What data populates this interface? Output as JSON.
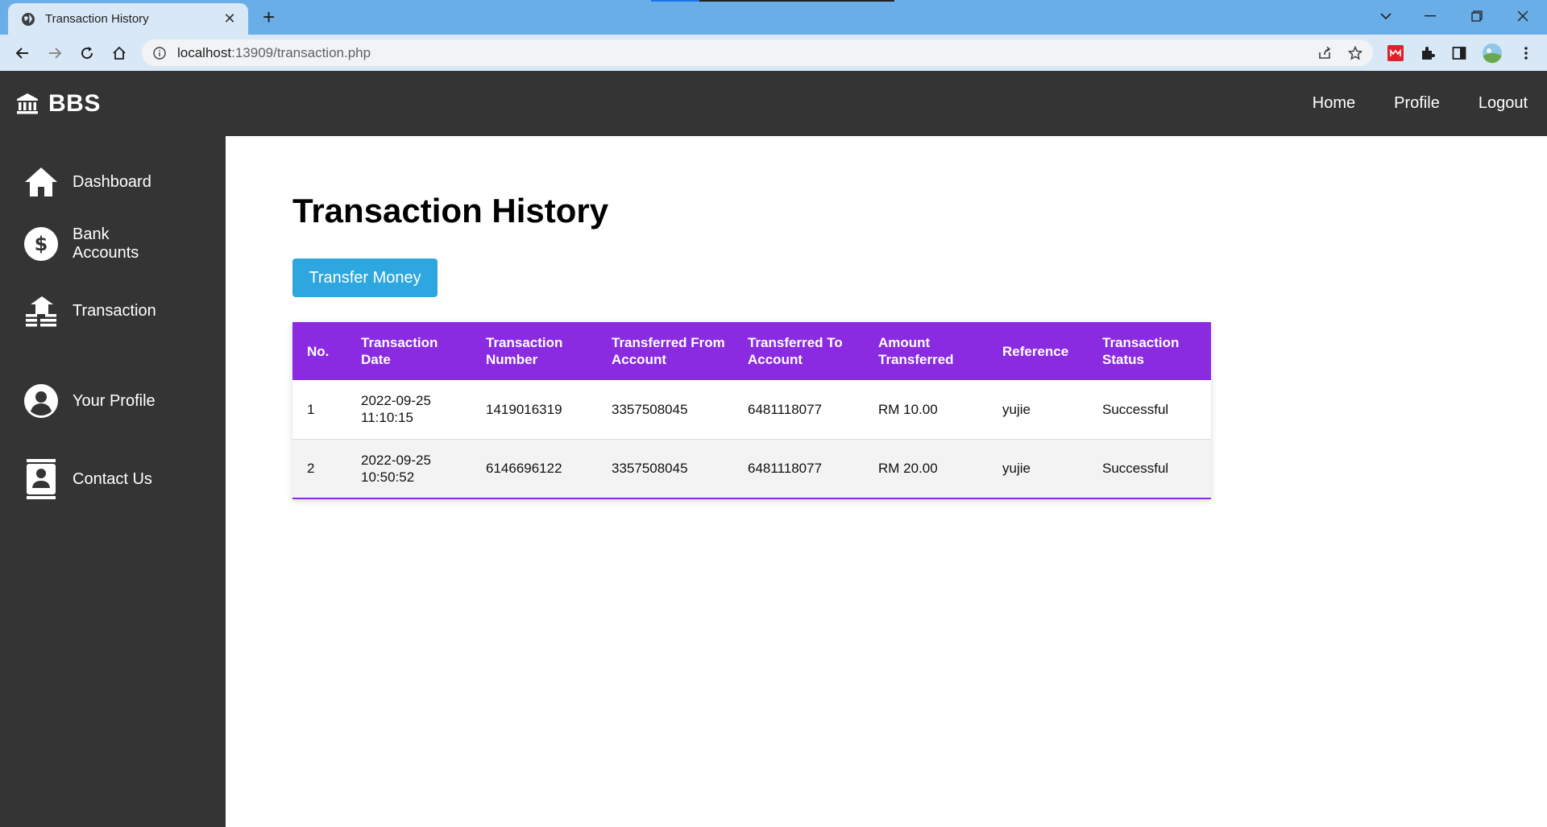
{
  "browser": {
    "tab_title": "Transaction History",
    "tab_close": "✕",
    "new_tab": "+",
    "url_host": "localhost",
    "url_rest": ":13909/transaction.php"
  },
  "header": {
    "brand": "BBS",
    "nav": [
      "Home",
      "Profile",
      "Logout"
    ]
  },
  "sidebar": {
    "items": [
      {
        "label": "Dashboard",
        "icon": "home-icon"
      },
      {
        "label": "Bank Accounts",
        "icon": "dollar-circle-icon"
      },
      {
        "label": "Transaction",
        "icon": "transaction-icon"
      },
      {
        "label": "Your Profile",
        "icon": "user-circle-icon"
      },
      {
        "label": "Contact Us",
        "icon": "contact-card-icon"
      }
    ]
  },
  "main": {
    "title": "Transaction History",
    "transfer_button": "Transfer Money",
    "table": {
      "columns": [
        "No.",
        "Transaction Date",
        "Transaction Number",
        "Transferred From Account",
        "Transferred To Account",
        "Amount Transferred",
        "Reference",
        "Transaction Status"
      ],
      "rows": [
        [
          "1",
          "2022-09-25 11:10:15",
          "1419016319",
          "3357508045",
          "6481118077",
          "RM 10.00",
          "yujie",
          "Successful"
        ],
        [
          "2",
          "2022-09-25 10:50:52",
          "6146696122",
          "3357508045",
          "6481118077",
          "RM 20.00",
          "yujie",
          "Successful"
        ]
      ]
    }
  },
  "colors": {
    "header_bg": "#343434",
    "table_header": "#8a2be2",
    "button": "#2ea6df",
    "browser_tabbar": "#6aaee8"
  }
}
